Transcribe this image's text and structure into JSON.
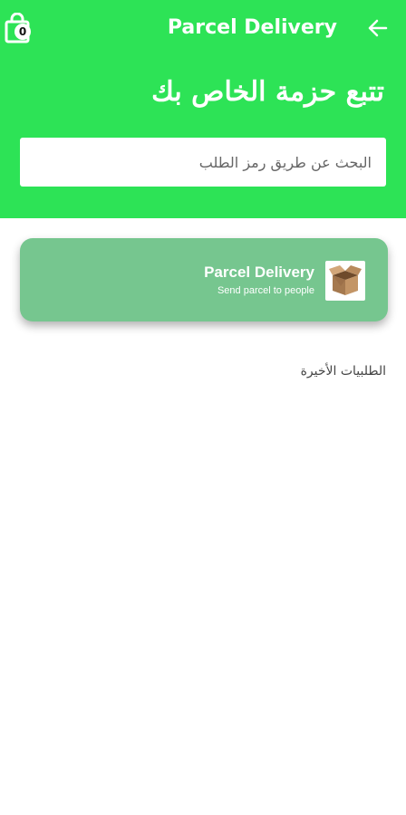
{
  "appbar": {
    "title": "Parcel Delivery",
    "cart_count": "0",
    "cart_icon": "cart-icon",
    "back_icon": "arrow-back-icon"
  },
  "hero": {
    "title": "تتبع حزمة الخاص بك"
  },
  "search": {
    "placeholder": "البحث عن طريق رمز الطلب",
    "value": ""
  },
  "service_card": {
    "title": "Parcel Delivery",
    "subtitle": "Send parcel to people",
    "icon": "parcel-box-icon"
  },
  "recent": {
    "label": "الطلبيات الأخيرة"
  },
  "colors": {
    "primary": "#2de356",
    "card": "#76c68f",
    "background": "#ffffff"
  }
}
